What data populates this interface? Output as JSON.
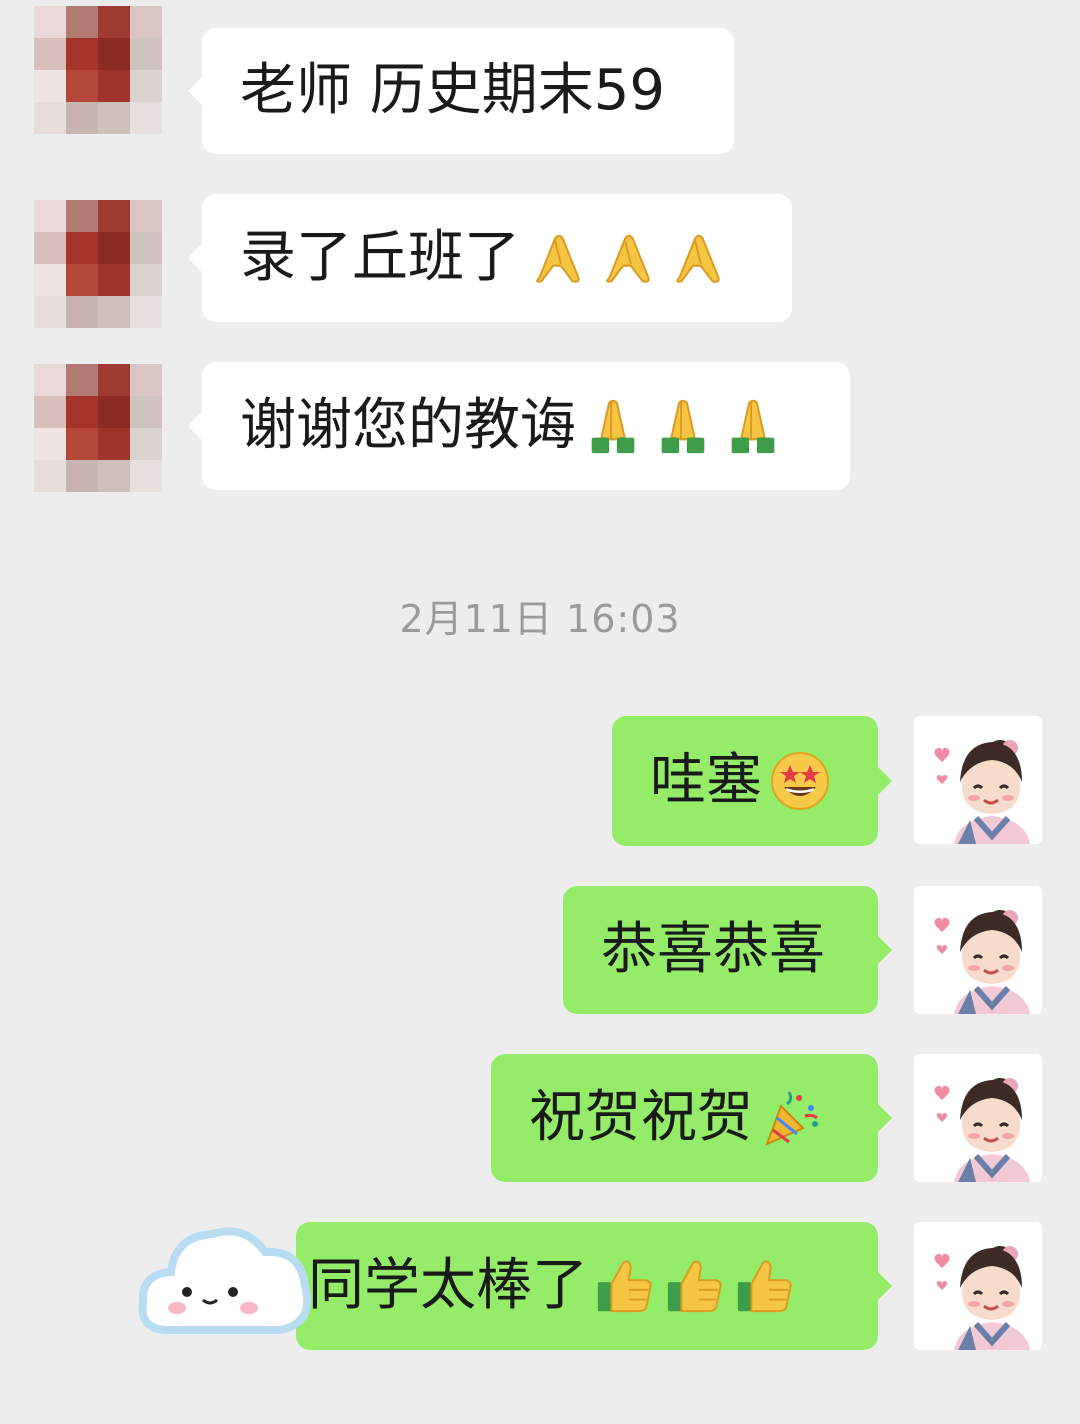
{
  "colors": {
    "background": "#ededed",
    "incoming_bubble": "#ffffff",
    "outgoing_bubble": "#95ec69",
    "timestamp_text": "#9a9a9a"
  },
  "incoming_messages": [
    {
      "text": "老师 历史期末59",
      "emoji": []
    },
    {
      "text": "录了丘班了",
      "emoji": [
        "pinched-fingers-icon",
        "pinched-fingers-icon",
        "pinched-fingers-icon"
      ]
    },
    {
      "text": "谢谢您的教诲",
      "emoji": [
        "folded-hands-icon",
        "folded-hands-icon",
        "folded-hands-icon"
      ]
    }
  ],
  "timestamp": "2月11日 16:03",
  "outgoing_messages": [
    {
      "text": "哇塞",
      "emoji": [
        "star-struck-face-icon"
      ]
    },
    {
      "text": "恭喜恭喜",
      "emoji": []
    },
    {
      "text": "祝贺祝贺",
      "emoji": [
        "party-popper-icon"
      ]
    },
    {
      "text": "同学太棒了",
      "emoji": [
        "thumbs-up-icon",
        "thumbs-up-icon",
        "thumbs-up-icon"
      ]
    }
  ]
}
